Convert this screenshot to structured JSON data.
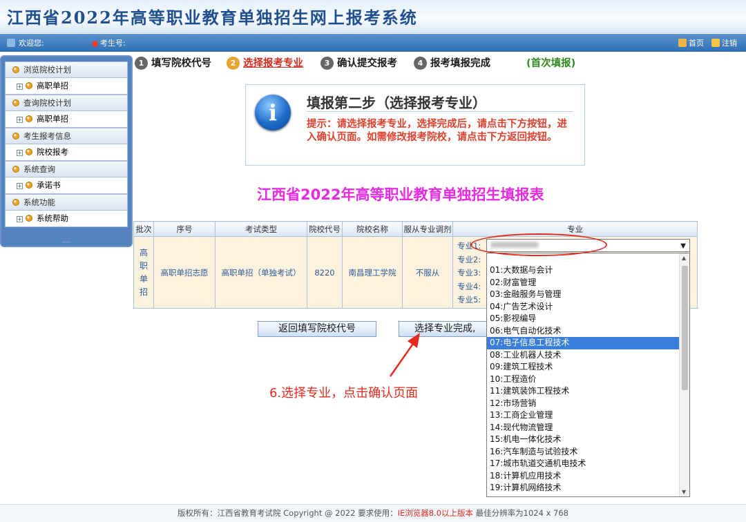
{
  "header": {
    "title": "江西省2022年高等职业教育单独招生网上报考系统"
  },
  "topbar": {
    "welcome": "欢迎您:",
    "exam_no": "考生号:",
    "home": "首页",
    "logout": "注销"
  },
  "sidebar": {
    "groups": [
      {
        "label": "浏览院校计划",
        "items": [
          "高职单招"
        ]
      },
      {
        "label": "查询院校计划",
        "items": [
          "高职单招"
        ]
      },
      {
        "label": "考生报考信息",
        "items": [
          "院校报考"
        ]
      },
      {
        "label": "系统查询",
        "items": [
          "承诺书"
        ]
      },
      {
        "label": "系统功能",
        "items": [
          "系统帮助"
        ]
      }
    ],
    "bottom_text": "....."
  },
  "steps": [
    {
      "num": "1",
      "label": "填写院校代号"
    },
    {
      "num": "2",
      "label": "选择报考专业"
    },
    {
      "num": "3",
      "label": "确认提交报考"
    },
    {
      "num": "4",
      "label": "报考填报完成"
    }
  ],
  "first_fill": "(首次填报)",
  "info": {
    "heading": "填报第二步（选择报考专业）",
    "text": "提示：请选择报考专业，选择完成后，请点击下方按钮，进入确认页面。如需修改报考院校，请点击下方返回按钮。"
  },
  "form_title": "江西省2022年高等职业教育单独招生填报表",
  "table": {
    "headers": [
      "批次",
      "序号",
      "考试类型",
      "院校代号",
      "院校名称",
      "服从专业调剂",
      "专业"
    ],
    "row": {
      "batch": [
        "高",
        "职",
        "单",
        "招"
      ],
      "seq": "高职单招志愿",
      "exam_type": "高职单招（单独考试）",
      "code": "8220",
      "school": "南昌理工学院",
      "adjust": "不服从",
      "major_labels": [
        "专业1:",
        "专业2:",
        "专业3:",
        "专业4:",
        "专业5:"
      ]
    }
  },
  "buttons": {
    "back": "返回填写院校代号",
    "done": "选择专业完成,"
  },
  "annotation": "6.选择专业，点击确认页面",
  "dropdown": {
    "selected_index": 6,
    "options": [
      "01:大数据与会计",
      "02:财富管理",
      "03:金融服务与管理",
      "04:广告艺术设计",
      "05:影视编导",
      "06:电气自动化技术",
      "07:电子信息工程技术",
      "08:工业机器人技术",
      "09:建筑工程技术",
      "10:工程造价",
      "11:建筑装饰工程技术",
      "12:市场营销",
      "13:工商企业管理",
      "14:现代物流管理",
      "15:机电一体化技术",
      "16:汽车制造与试验技术",
      "17:城市轨道交通机电技术",
      "18:计算机应用技术",
      "19:计算机网络技术"
    ]
  },
  "footer": {
    "prefix": "版权所有：江西省教育考试院 Copyright @ 2022 要求使用：",
    "browser": "IE浏览器8.0以上版本",
    "suffix": " 最佳分辨率为1024 x 768"
  },
  "colors": {
    "accent_red": "#e0291d",
    "title_magenta": "#e829e5",
    "selected_option": "#3b7ed9",
    "nav_blue": "#2f6fb4"
  }
}
